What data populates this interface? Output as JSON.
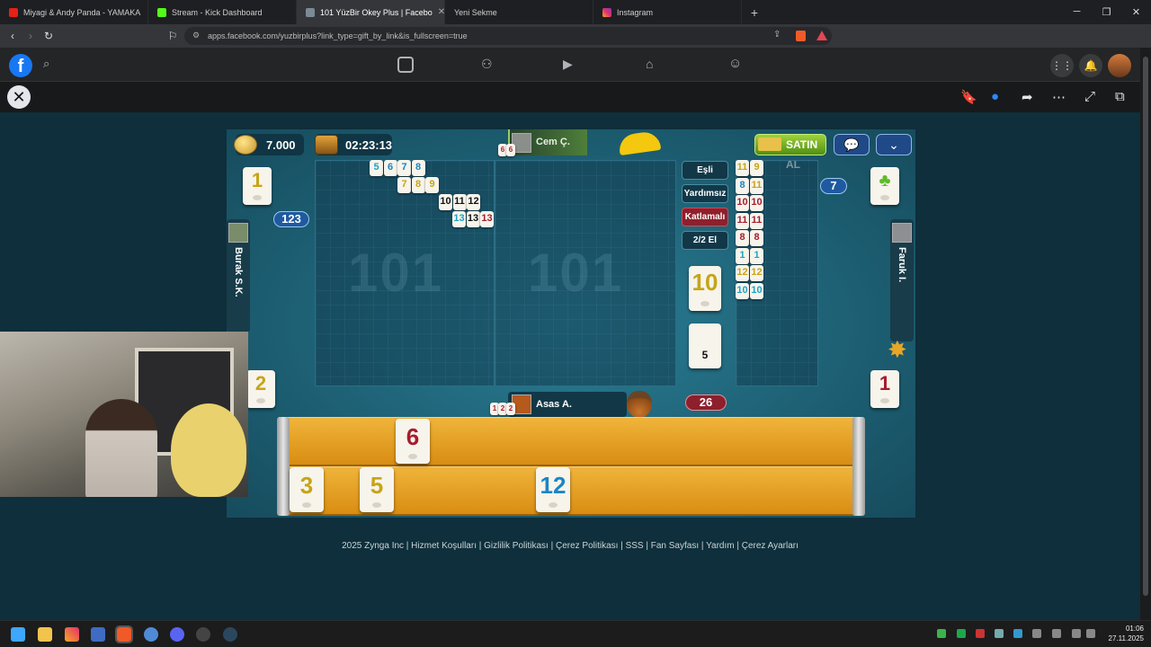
{
  "browser": {
    "tabs": [
      {
        "title": "Miyagi & Andy Panda - YAMAKA",
        "active": false,
        "closable": false
      },
      {
        "title": "Stream - Kick Dashboard",
        "active": false,
        "closable": false
      },
      {
        "title": "101 YüzBir Okey Plus | Facebo",
        "active": true,
        "closable": true
      },
      {
        "title": "Yeni Sekme",
        "active": false,
        "closable": false
      },
      {
        "title": "Instagram",
        "active": false,
        "closable": false
      }
    ],
    "url": "apps.facebook.com/yuzbirplus?link_type=gift_by_link&is_fullscreen=true"
  },
  "game": {
    "coins": "7.000",
    "timer": "02:23:13",
    "top_player": "Cem Ç.",
    "top_player_tiles": [
      "6",
      "6"
    ],
    "buy_label": "SATIN AL",
    "left_player": "Burak S.K.",
    "right_player": "Faruk I.",
    "bottom_player": "Asas A.",
    "bottom_player_tiles": [
      "1",
      "2",
      "2"
    ],
    "left_score": "123",
    "right_count": "7",
    "bottom_count": "26",
    "deck_count": "5",
    "okey_indicator": "10",
    "settings": [
      "Eşli",
      "Yardımsız",
      "Katlamalı",
      "2/2 El"
    ],
    "left_top_discard": "1",
    "left_bottom_discard": "2",
    "right_bottom_discard": "1",
    "table_runs": [
      {
        "tiles": [
          {
            "v": "5",
            "c": "cyan"
          },
          {
            "v": "6",
            "c": "blue"
          },
          {
            "v": "7",
            "c": "blue"
          },
          {
            "v": "8",
            "c": "blue"
          }
        ]
      },
      {
        "tiles": [
          {
            "v": "7",
            "c": "yel"
          },
          {
            "v": "8",
            "c": "yel"
          },
          {
            "v": "9",
            "c": "yel"
          }
        ]
      },
      {
        "tiles": [
          {
            "v": "10",
            "c": "blk"
          },
          {
            "v": "11",
            "c": "blk"
          },
          {
            "v": "12",
            "c": "blk"
          }
        ]
      },
      {
        "tiles": [
          {
            "v": "13",
            "c": "cyan"
          },
          {
            "v": "13",
            "c": "blk"
          },
          {
            "v": "13",
            "c": "red"
          }
        ]
      }
    ],
    "right_pairs": [
      [
        {
          "v": "11",
          "c": "yel"
        },
        {
          "v": "9",
          "c": "yel"
        }
      ],
      [
        {
          "v": "8",
          "c": "blue"
        },
        {
          "v": "11",
          "c": "yel"
        }
      ],
      [
        {
          "v": "10",
          "c": "red"
        },
        {
          "v": "10",
          "c": "red"
        }
      ],
      [
        {
          "v": "11",
          "c": "red"
        },
        {
          "v": "11",
          "c": "red"
        }
      ],
      [
        {
          "v": "8",
          "c": "red"
        },
        {
          "v": "8",
          "c": "red"
        }
      ],
      [
        {
          "v": "1",
          "c": "cyan"
        },
        {
          "v": "1",
          "c": "cyan"
        }
      ],
      [
        {
          "v": "12",
          "c": "yel"
        },
        {
          "v": "12",
          "c": "yel"
        }
      ],
      [
        {
          "v": "10",
          "c": "cyan"
        },
        {
          "v": "10",
          "c": "cyan"
        }
      ]
    ],
    "rack_top": [
      {
        "v": "6",
        "c": "red"
      }
    ],
    "rack_bottom": [
      {
        "v": "3",
        "c": "yel"
      },
      {
        "v": "5",
        "c": "yel"
      },
      {
        "v": "12",
        "c": "blue"
      }
    ]
  },
  "footer": "2025 Zynga Inc | Hizmet Koşulları | Gizlilik Politikası | Çerez Politikası | SSS | Fan Sayfası | Yardım | Çerez Ayarları",
  "clock": {
    "time": "01:06",
    "date": "27.11.2025"
  }
}
